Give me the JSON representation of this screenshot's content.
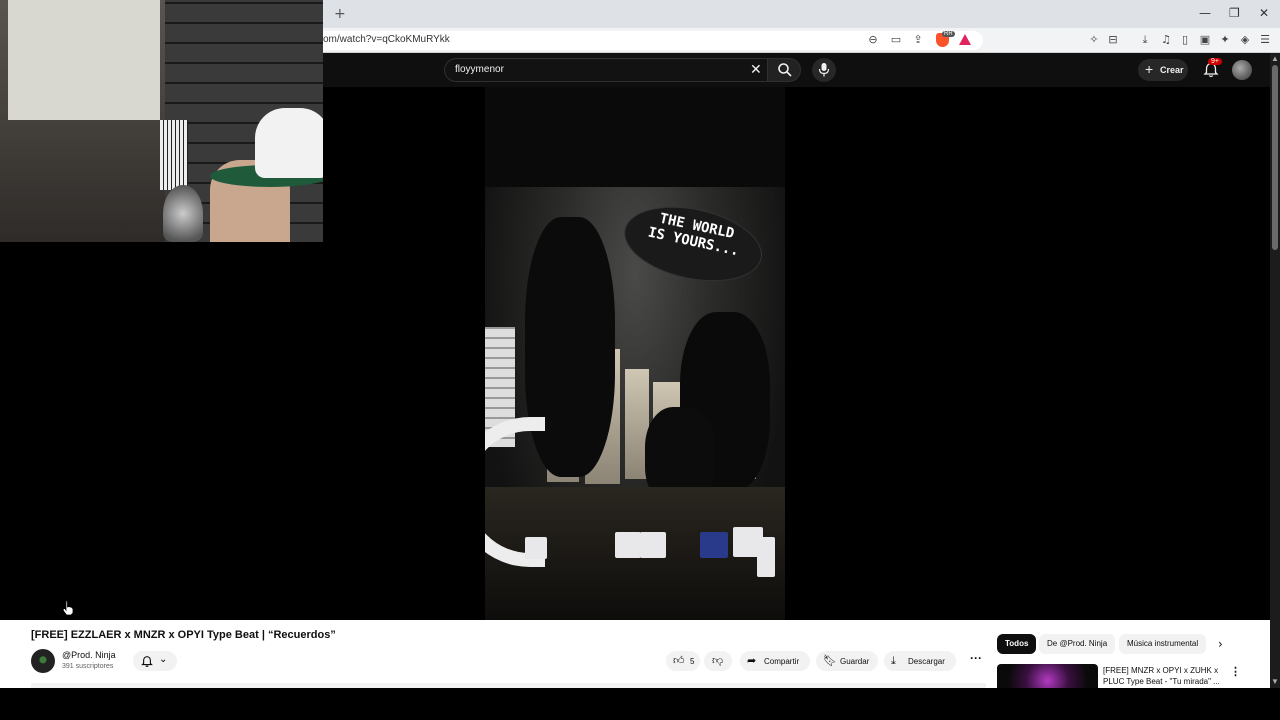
{
  "browser": {
    "new_tab": "+",
    "url": "om/watch?v=qCkoKMuRYkk",
    "brave_badge": "RR",
    "window_controls": [
      "—",
      "❐",
      "✕"
    ]
  },
  "yt_header": {
    "search_value": "floyymenor",
    "create_label": "Crear",
    "notif_badge": "9+"
  },
  "video": {
    "overlay_text": "THE WORLD IS YOURS..."
  },
  "watch": {
    "title": "[FREE] EZZLAER x MNZR x OPYI Type Beat | “Recuerdos”",
    "channel_name": "@Prod. Ninja",
    "subscribers": "391 suscriptores",
    "likes": "5",
    "share_label": "Compartir",
    "save_label": "Guardar",
    "download_label": "Descargar",
    "more_label": "···"
  },
  "chips": {
    "items": [
      "Todos",
      "De @Prod. Ninja",
      "Música instrumental"
    ],
    "next": "›"
  },
  "recommended": {
    "title": "[FREE] MNZR x OPYI x ZUHK x PLUC Type Beat - \"Tu mirada\" ..."
  }
}
